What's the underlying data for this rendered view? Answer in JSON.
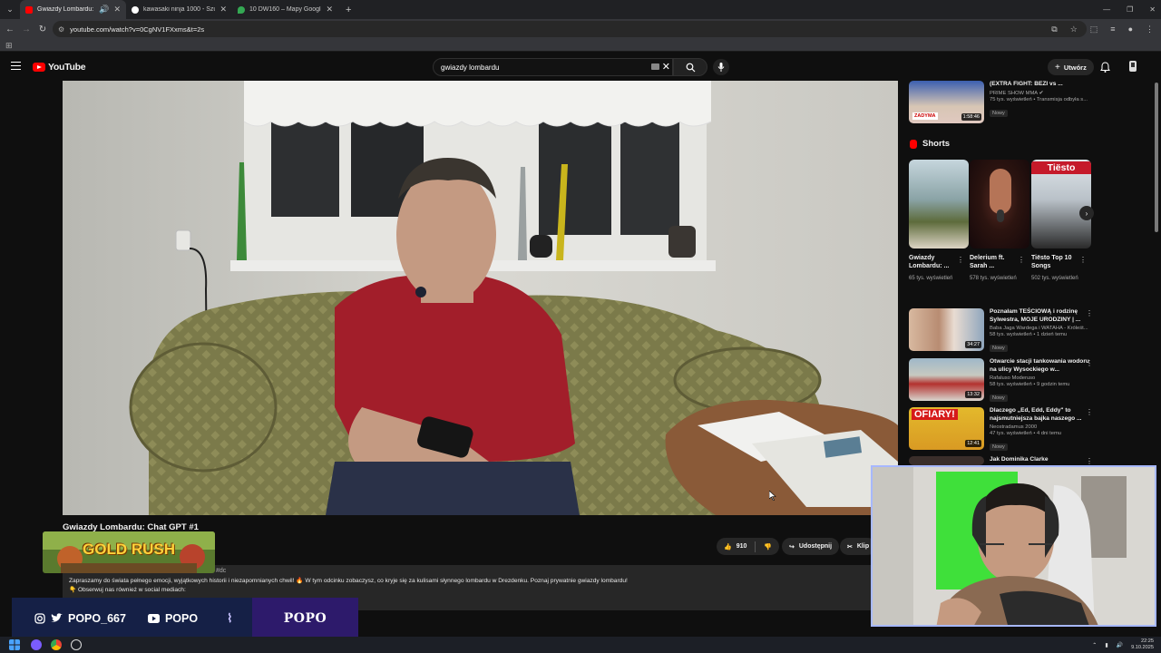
{
  "browser": {
    "tabs": [
      {
        "title": "Gwiazdy Lombardu: Chat G",
        "active": true,
        "favicon_color": "#ff0000"
      },
      {
        "title": "kawasaki ninja 1000 - Szukaj w",
        "active": false,
        "favicon_color": "#ffffff"
      },
      {
        "title": "10 DW160 – Mapy Google",
        "active": false,
        "favicon_color": "#34a853"
      }
    ],
    "url": "youtube.com/watch?v=0CgNV1FXxms&t=2s"
  },
  "youtube": {
    "logo_text": "YouTube",
    "search_query": "gwiazdy lombardu",
    "create_label": "Utwórz",
    "video_title": "Gwiazdy Lombardu: Chat GPT #1",
    "like_count": "910",
    "share_label": "Udostępnij",
    "clip_label": "Klip",
    "description": {
      "hashtag": "#dc",
      "line1": "Zapraszamy do świata pełnego emocji, wyjątkowych historii i niezapomnianych chwil! 🔥 W tym odcinku zobaczysz, co kryje się za kulisami słynnego lombardu w Drezdenku. Poznaj prywatnie gwiazdy lombardu!",
      "line2": "👇 Obserwuj nas również w social mediach:"
    },
    "top_rec": {
      "title": "(EXTRA FIGHT: BEZI vs ...",
      "channel": "PRIME SHOW MMA",
      "meta": "75 tys. wyświetleń • Transmisja odbyła s...",
      "badge": "Nowy",
      "duration": "1:58:46",
      "thumb_label": "ZADYMA"
    },
    "shorts_header": "Shorts",
    "shorts": [
      {
        "title": "Gwiazdy Lombardu: ...",
        "views": "65 tys. wyświetleń"
      },
      {
        "title": "Delerium ft. Sarah ...",
        "views": "578 tys. wyświetleń"
      },
      {
        "title": "Tiësto Top 10 Songs",
        "views": "502 tys. wyświetleń",
        "overlay": "Tiësto"
      }
    ],
    "recommendations": [
      {
        "title": "Poznałam TEŚCIOWĄ i rodzinę Sylwestra, MOJE URODZINY | ...",
        "channel": "Baba Jaga Wardega i WATAHA - Króleśt...",
        "meta": "58 tys. wyświetleń • 1 dzień temu",
        "badge": "Nowy",
        "duration": "34:27"
      },
      {
        "title": "Otwarcie stacji tankowania wodoru na ulicy Wysockiego w...",
        "channel": "Rafaluso Moderuso",
        "meta": "58 tys. wyświetleń • 9 godzin temu",
        "badge": "Nowy",
        "duration": "13:32"
      },
      {
        "title": "Dlaczego „Ed, Edd, Eddy\" to najsmutniejsza bajka naszego ...",
        "channel": "Neostradamus 2000",
        "meta": "47 tys. wyświetleń • 4 dni temu",
        "badge": "Nowy",
        "duration": "12:41",
        "thumb_label": "OFIARY!"
      },
      {
        "title": "Jak Dominika Clarke",
        "channel": "",
        "meta": "",
        "badge": "",
        "duration": ""
      }
    ]
  },
  "overlay": {
    "game_banner": "GOLD RUSH",
    "social_handle": "POPO_667",
    "youtube_handle": "POPO",
    "brand": "POPO"
  },
  "taskbar": {
    "time": "22:25",
    "date": "9.10.2025"
  },
  "colors": {
    "yt_red": "#ff0000",
    "bg": "#0f0f0f",
    "webcam_border": "#a7b8ff",
    "social_bar": "#152046",
    "brand_box": "#2d1a6b"
  }
}
